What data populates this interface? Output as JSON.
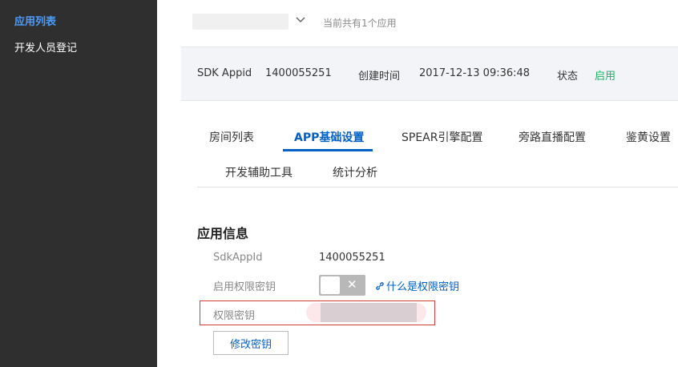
{
  "sidebar": {
    "items": [
      {
        "label": "应用列表",
        "active": true
      },
      {
        "label": "开发人员登记",
        "active": false
      }
    ]
  },
  "header": {
    "app_count_text": "当前共有1个应用",
    "dropdown_icon": "chevron-down-icon"
  },
  "info": {
    "sdk_appid_label": "SDK Appid",
    "sdk_appid_value": "1400055251",
    "created_label": "创建时间",
    "created_value": "2017-12-13 09:36:48",
    "status_label": "状态",
    "status_value": "启用",
    "status_color": "#1ab064"
  },
  "tabs": [
    {
      "label": "房间列表",
      "active": false
    },
    {
      "label": "APP基础设置",
      "active": true
    },
    {
      "label": "SPEAR引擎配置",
      "active": false
    },
    {
      "label": "旁路直播配置",
      "active": false
    },
    {
      "label": "鉴黄设置",
      "active": false
    },
    {
      "label": "开发辅助工具",
      "active": false
    },
    {
      "label": "统计分析",
      "active": false
    }
  ],
  "app_info": {
    "section_title": "应用信息",
    "sdkappid_label": "SdkAppId",
    "sdkappid_value": "1400055251",
    "permission_key_enable_label": "启用权限密钥",
    "permission_key_enabled": false,
    "toggle_off_icon": "close-icon",
    "help_link_icon": "link-icon",
    "help_link_text": "什么是权限密钥",
    "permission_key_label": "权限密钥",
    "modify_key_button": "修改密钥"
  },
  "colors": {
    "accent": "#0060c8",
    "sidebar_bg": "#2f2f2f",
    "sidebar_active": "#4c9dff",
    "highlight_border": "#d43c3c"
  }
}
